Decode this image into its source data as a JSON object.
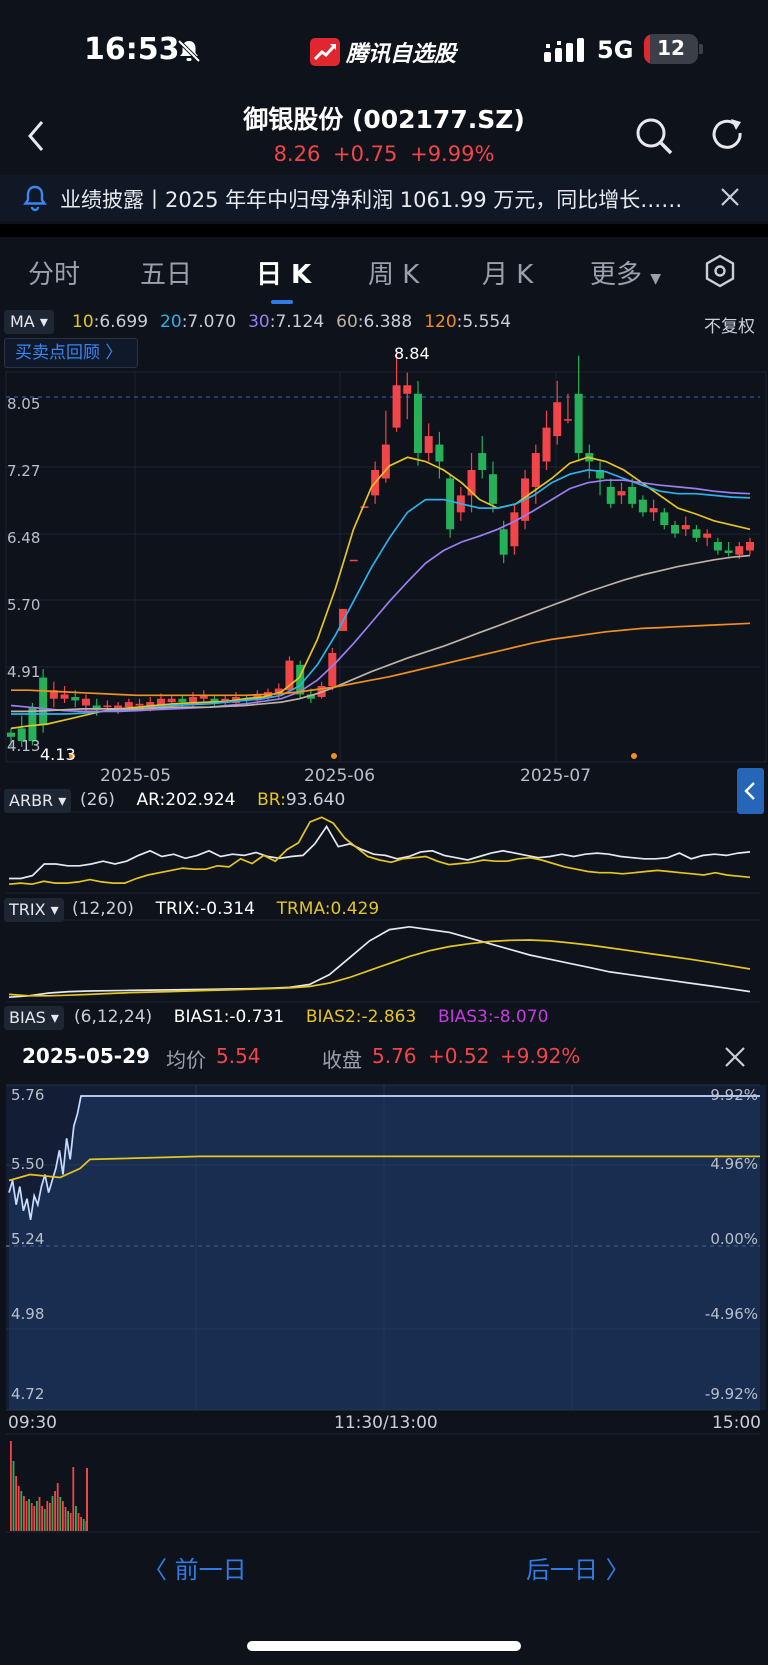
{
  "status_bar": {
    "time": "16:53",
    "app_name": "腾讯自选股",
    "network": "5G",
    "battery": "12",
    "battery_level": 0.12
  },
  "header": {
    "title": "御银股份 (002177.SZ)",
    "price": "8.26",
    "change": "+0.75",
    "change_pct": "+9.99%"
  },
  "notice": {
    "text": "业绩披露丨2025 年年中归母净利润 1061.99 万元，同比增长……"
  },
  "tabs": [
    {
      "label": "分时"
    },
    {
      "label": "五日"
    },
    {
      "label": "日 K"
    },
    {
      "label": "周 K"
    },
    {
      "label": "月 K"
    },
    {
      "label": "更多"
    }
  ],
  "active_tab": "日 K",
  "kline": {
    "indicator": "MA",
    "ma": [
      {
        "name": "10",
        "value": ":6.699",
        "color": "#e5c51f"
      },
      {
        "name": "20",
        "value": ":7.070",
        "color": "#2ab3ea"
      },
      {
        "name": "30",
        "value": ":7.124",
        "color": "#9c7df2"
      },
      {
        "name": "60",
        "value": ":6.388",
        "color": "#bfb2a4"
      },
      {
        "name": "120",
        "value": ":5.554",
        "color": "#f0901e"
      }
    ],
    "adjust": "不复权",
    "replay": "买卖点回顾 〉",
    "high_label": "8.84",
    "low_label": "4.13",
    "y_ticks": [
      "8.05",
      "7.27",
      "6.48",
      "5.70",
      "4.91",
      "4.13"
    ],
    "x_ticks": [
      "2025-05",
      "2025-06",
      "2025-07"
    ]
  },
  "arbr": {
    "name": "ARBR",
    "param": "(26)",
    "ar_label": "AR:",
    "ar": "202.924",
    "br_label": "BR:",
    "br": "93.640"
  },
  "trix": {
    "name": "TRIX",
    "param": "(12,20)",
    "trix_label": "TRIX:",
    "trix": "-0.314",
    "trma_label": "TRMA:",
    "trma": "0.429"
  },
  "bias": {
    "name": "BIAS",
    "param": "(6,12,24)",
    "b1_label": "BIAS1:",
    "b1": "-0.731",
    "b2_label": "BIAS2:",
    "b2": "-2.863",
    "b3_label": "BIAS3:",
    "b3": "-8.070"
  },
  "intraday": {
    "date": "2025-05-29",
    "avg_label": "均价",
    "avg": "5.54",
    "close_label": "收盘",
    "close": "5.76",
    "close_change": "+0.52",
    "close_pct": "+9.92%",
    "y_left": [
      "5.76",
      "5.50",
      "5.24",
      "4.98",
      "4.72"
    ],
    "y_right": [
      "9.92%",
      "4.96%",
      "0.00%",
      "-4.96%",
      "-9.92%"
    ],
    "x_ticks": [
      "09:30",
      "11:30/13:00",
      "15:00"
    ]
  },
  "nav": {
    "prev": "〈 前一日",
    "next": "后一日 〉"
  },
  "colors": {
    "up": "#f2454a",
    "down": "#26b057",
    "accent": "#2f7ce8",
    "bg": "#0e121b"
  }
}
